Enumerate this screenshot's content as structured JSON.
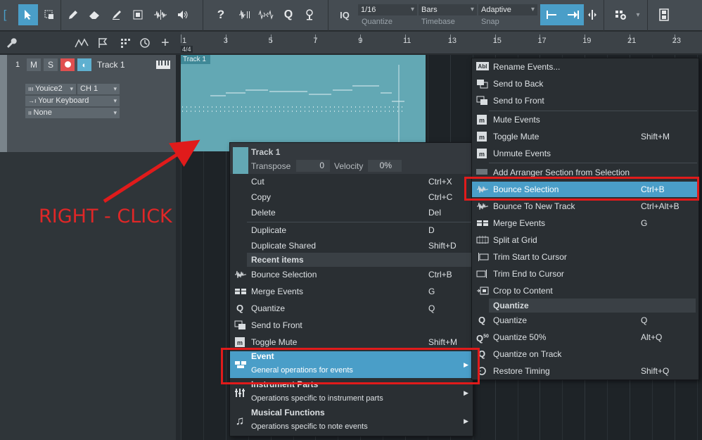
{
  "toolbar": {
    "quantize": {
      "value": "1/16",
      "label": "Quantize"
    },
    "timebase": {
      "value": "Bars",
      "label": "Timebase"
    },
    "snap": {
      "value": "Adaptive",
      "label": "Snap"
    },
    "iq_label": "IQ",
    "help_label": "?",
    "q_label": "Q"
  },
  "ruler": {
    "numbers": [
      "1",
      "3",
      "5",
      "7",
      "9",
      "11",
      "13",
      "15",
      "17",
      "19",
      "21",
      "23"
    ],
    "time_sig": "4/4"
  },
  "track": {
    "number": "1",
    "mute": "M",
    "solo": "S",
    "name": "Track 1",
    "instrument": "Youice2",
    "channel": "CH 1",
    "input": "Your Keyboard",
    "output": "None",
    "event_label": "Track 1"
  },
  "annotation": {
    "right_click": "RIGHT - CLICK"
  },
  "context_menu": {
    "header": {
      "title": "Track 1",
      "transpose_label": "Transpose",
      "transpose_value": "0",
      "velocity_label": "Velocity",
      "velocity_value": "0%"
    },
    "items": [
      {
        "label": "Cut",
        "shortcut": "Ctrl+X"
      },
      {
        "label": "Copy",
        "shortcut": "Ctrl+C"
      },
      {
        "label": "Delete",
        "shortcut": "Del"
      },
      {
        "label": "Duplicate",
        "shortcut": "D"
      },
      {
        "label": "Duplicate Shared",
        "shortcut": "Shift+D"
      }
    ],
    "recent_header": "Recent items",
    "recent": [
      {
        "label": "Bounce Selection",
        "shortcut": "Ctrl+B",
        "icon": "waveform-icon"
      },
      {
        "label": "Merge Events",
        "shortcut": "G",
        "icon": "merge-icon"
      },
      {
        "label": "Quantize",
        "shortcut": "Q",
        "icon": "quantize-icon"
      },
      {
        "label": "Send to Front",
        "shortcut": "",
        "icon": "send-front-icon"
      },
      {
        "label": "Toggle Mute",
        "shortcut": "Shift+M",
        "icon": "mute-icon"
      }
    ],
    "submenus": [
      {
        "title": "Event",
        "subtitle": "General operations for events",
        "icon": "event-icon"
      },
      {
        "title": "Instrument Parts",
        "subtitle": "Operations specific to instrument parts",
        "icon": "instrument-icon"
      },
      {
        "title": "Musical Functions",
        "subtitle": "Operations specific to note events",
        "icon": "music-note-icon"
      }
    ]
  },
  "event_menu": {
    "items": [
      {
        "label": "Rename Events...",
        "shortcut": "",
        "icon": "rename-icon"
      },
      {
        "label": "Send to Back",
        "shortcut": "",
        "icon": "send-back-icon"
      },
      {
        "label": "Send to Front",
        "shortcut": "",
        "icon": "send-front-icon"
      },
      {
        "label": "Mute Events",
        "shortcut": "",
        "icon": "mute-icon"
      },
      {
        "label": "Toggle Mute",
        "shortcut": "Shift+M",
        "icon": "mute-icon"
      },
      {
        "label": "Unmute Events",
        "shortcut": "",
        "icon": "mute-icon"
      },
      {
        "label": "Add Arranger Section from Selection",
        "shortcut": "",
        "icon": "arranger-icon"
      },
      {
        "label": "Bounce Selection",
        "shortcut": "Ctrl+B",
        "icon": "waveform-icon"
      },
      {
        "label": "Bounce To New Track",
        "shortcut": "Ctrl+Alt+B",
        "icon": "waveform-icon"
      },
      {
        "label": "Merge Events",
        "shortcut": "G",
        "icon": "merge-icon"
      },
      {
        "label": "Split at Grid",
        "shortcut": "",
        "icon": "split-icon"
      },
      {
        "label": "Trim Start to Cursor",
        "shortcut": "",
        "icon": "trim-start-icon"
      },
      {
        "label": "Trim End to Cursor",
        "shortcut": "",
        "icon": "trim-end-icon"
      },
      {
        "label": "Crop to Content",
        "shortcut": "",
        "icon": "crop-icon"
      }
    ],
    "quantize_header": "Quantize",
    "quantize_items": [
      {
        "label": "Quantize",
        "shortcut": "Q",
        "icon": "quantize-icon"
      },
      {
        "label": "Quantize 50%",
        "shortcut": "Alt+Q",
        "icon": "quantize-50-icon"
      },
      {
        "label": "Quantize on Track",
        "shortcut": "",
        "icon": "quantize-icon"
      },
      {
        "label": "Restore Timing",
        "shortcut": "Shift+Q",
        "icon": "restore-icon"
      }
    ]
  },
  "colors": {
    "accent": "#4a9ec8",
    "annotation": "#e01b1b",
    "event": "#63a8b4",
    "record": "#e05050"
  }
}
